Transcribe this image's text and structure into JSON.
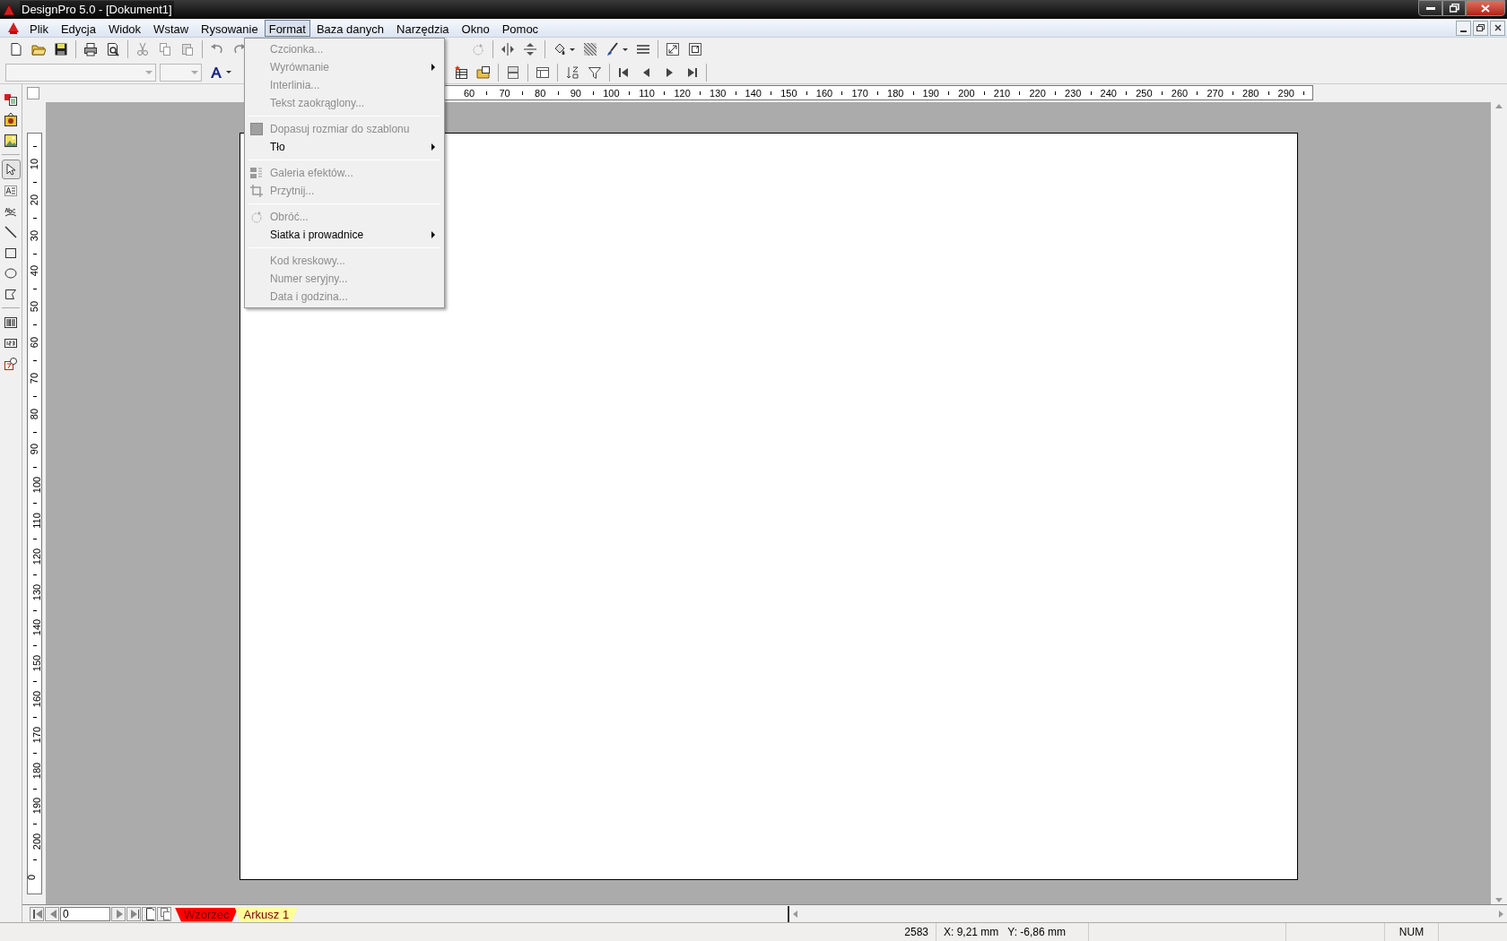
{
  "window": {
    "title": "DesignPro 5.0 - [Dokument1]"
  },
  "menu_bar": [
    {
      "label": "Plik",
      "selected": false
    },
    {
      "label": "Edycja",
      "selected": false
    },
    {
      "label": "Widok",
      "selected": false
    },
    {
      "label": "Wstaw",
      "selected": false
    },
    {
      "label": "Rysowanie",
      "selected": false
    },
    {
      "label": "Format",
      "selected": true
    },
    {
      "label": "Baza danych",
      "selected": false
    },
    {
      "label": "Narzędzia",
      "selected": false
    },
    {
      "label": "Okno",
      "selected": false
    },
    {
      "label": "Pomoc",
      "selected": false
    }
  ],
  "format_menu": [
    {
      "kind": "item",
      "label": "Czcionka...",
      "disabled": true,
      "submenu": false,
      "checked": false
    },
    {
      "kind": "item",
      "label": "Wyrównanie",
      "disabled": true,
      "submenu": true,
      "checked": false
    },
    {
      "kind": "item",
      "label": "Interlinia...",
      "disabled": true,
      "submenu": false,
      "checked": false
    },
    {
      "kind": "item",
      "label": "Tekst zaokrąglony...",
      "disabled": true,
      "submenu": false,
      "checked": false
    },
    {
      "kind": "separator"
    },
    {
      "kind": "item",
      "label": "Dopasuj rozmiar do szablonu",
      "disabled": true,
      "submenu": false,
      "checked": true
    },
    {
      "kind": "item",
      "label": "Tło",
      "disabled": false,
      "submenu": true,
      "checked": false
    },
    {
      "kind": "separator"
    },
    {
      "kind": "item",
      "label": "Galeria efektów...",
      "disabled": true,
      "submenu": false,
      "checked": false
    },
    {
      "kind": "item",
      "label": "Przytnij...",
      "disabled": true,
      "submenu": false,
      "checked": false
    },
    {
      "kind": "separator"
    },
    {
      "kind": "item",
      "label": "Obróć...",
      "disabled": true,
      "submenu": false,
      "checked": false
    },
    {
      "kind": "item",
      "label": "Siatka i prowadnice",
      "disabled": false,
      "submenu": true,
      "checked": false
    },
    {
      "kind": "separator"
    },
    {
      "kind": "item",
      "label": "Kod kreskowy...",
      "disabled": true,
      "submenu": false,
      "checked": false
    },
    {
      "kind": "item",
      "label": "Numer seryjny...",
      "disabled": true,
      "submenu": false,
      "checked": false
    },
    {
      "kind": "item",
      "label": "Data i godzina...",
      "disabled": true,
      "submenu": false,
      "checked": false
    }
  ],
  "horizontal_ruler": [
    "60",
    "70",
    "80",
    "90",
    "100",
    "110",
    "120",
    "130",
    "140",
    "150",
    "160",
    "170",
    "180",
    "190",
    "200",
    "210",
    "220",
    "230",
    "240",
    "250",
    "260",
    "270",
    "280",
    "290"
  ],
  "vertical_ruler": [
    "10",
    "20",
    "30",
    "40",
    "50",
    "60",
    "70",
    "80",
    "90",
    "100",
    "110",
    "120",
    "130",
    "140",
    "150",
    "160",
    "170",
    "180",
    "190",
    "200",
    "0"
  ],
  "page_navigation": {
    "value": "0"
  },
  "sheet_tabs": [
    {
      "label": "Wzorzec",
      "color": "#ff0000"
    },
    {
      "label": "Arkusz 1",
      "color": "#ffff99"
    }
  ],
  "status_bar": {
    "count": "2583",
    "x": "X: 9,21 mm",
    "y": "Y: -6,86 mm",
    "mode": "NUM"
  }
}
